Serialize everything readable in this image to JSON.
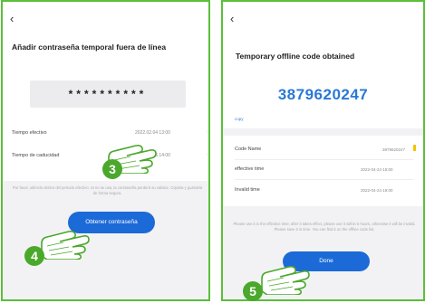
{
  "left_screen": {
    "back_icon": "back-arrow-icon",
    "title": "Añadir contraseña temporal fuera de línea",
    "password_mask": "**********",
    "effective_label": "Tiempo efectivo",
    "effective_value": "2022.02.04 13:00",
    "expiry_label": "Tiempo de caducidad",
    "expiry_value": "2022.02.05 14:00",
    "note": "Por favor, utilícelo dentro del periodo efectivo. Si no se usa, la contraseña perderá su validez. Cópiela y guárdela de forma segura.",
    "button_label": "Obtener contraseña"
  },
  "right_screen": {
    "back_icon": "back-arrow-icon",
    "title": "Temporary offline code obtained",
    "code": "3879620247",
    "copy_label": "copy",
    "code_name_label": "Code Name",
    "code_name_value": "3879620247",
    "effective_label": "effective time",
    "effective_value": "2022-04-24 15:00",
    "invalid_label": "Invalid time",
    "invalid_value": "2022-04-24 19:00",
    "note": "Please use it in the effective time; after it takes effect, please use it within 6 hours, otherwise it will be invalid. Please save it in time. You can find it on the offline code list.",
    "button_label": "Done"
  },
  "steps": {
    "step3": "3",
    "step4": "4",
    "step5": "5"
  },
  "colors": {
    "frame_border": "#5bbf3a",
    "accent_blue": "#1c6ad8",
    "code_blue": "#2a78d6",
    "step_green": "#4aa82b"
  }
}
